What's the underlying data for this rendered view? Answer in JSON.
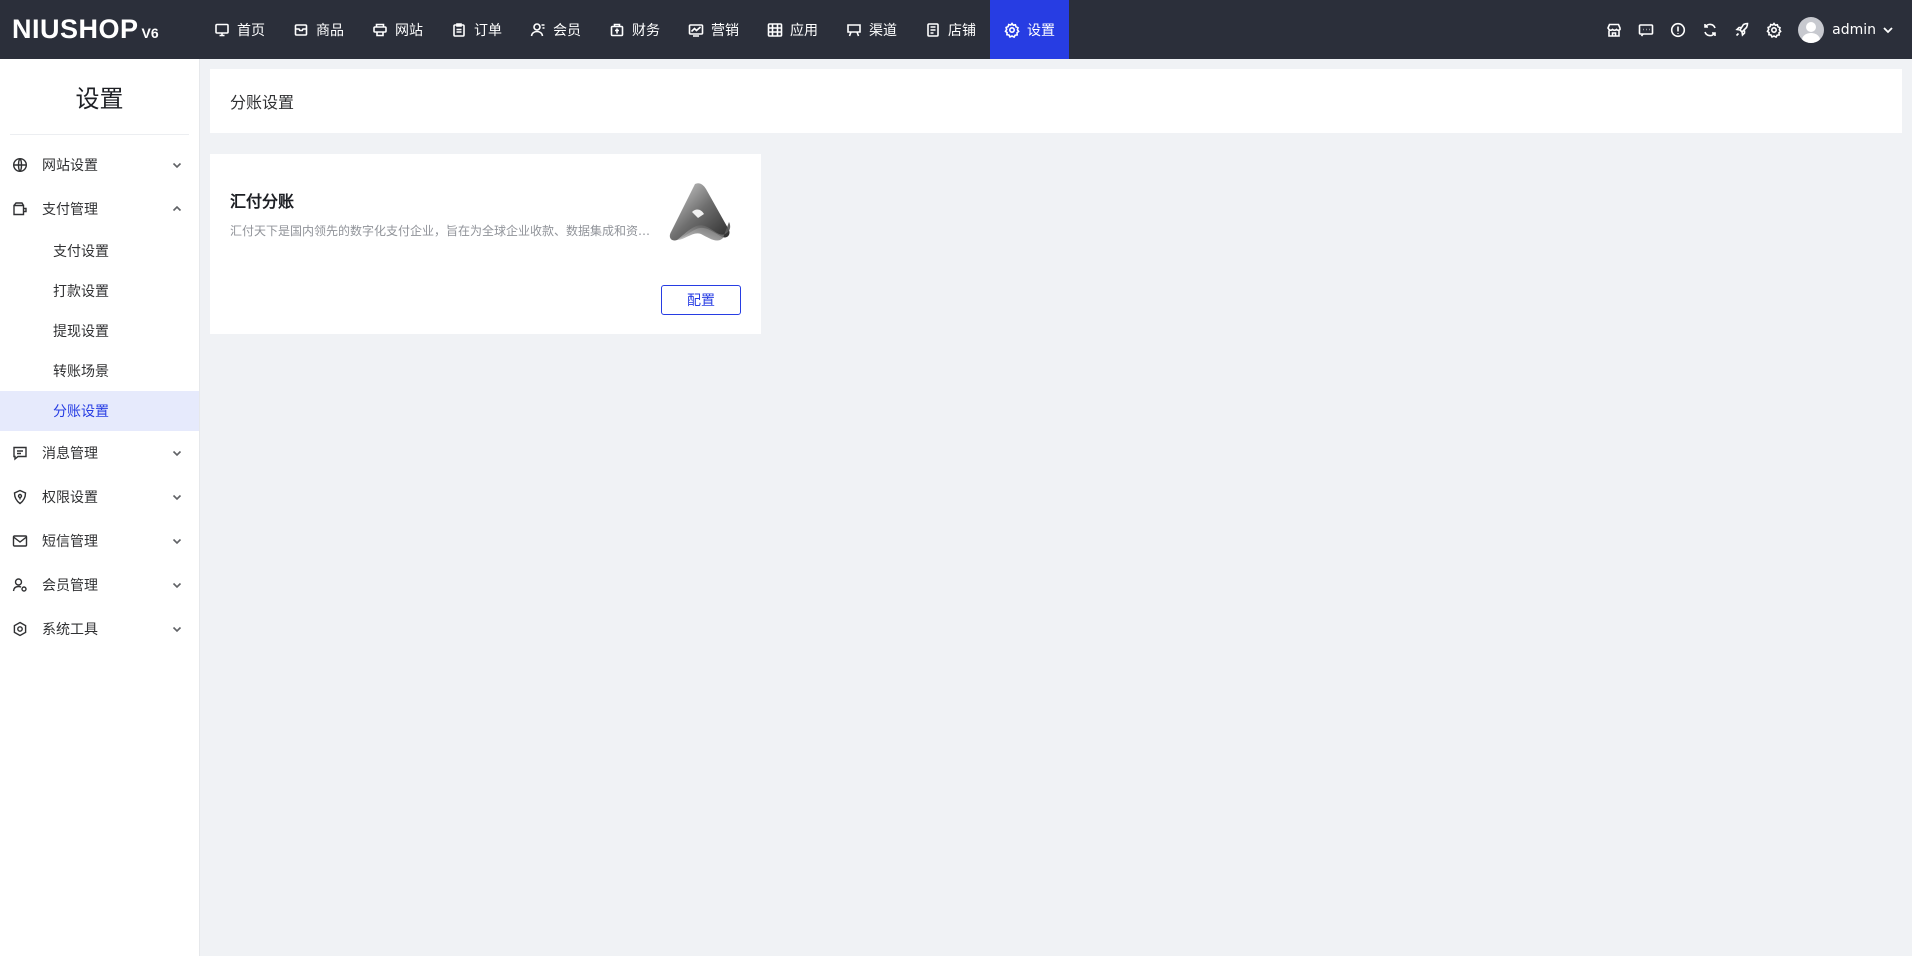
{
  "logo": {
    "text": "NIUSHOP",
    "version": "V6"
  },
  "nav": [
    {
      "label": "首页",
      "icon": "monitor-icon",
      "active": false
    },
    {
      "label": "商品",
      "icon": "box-icon",
      "active": false
    },
    {
      "label": "网站",
      "icon": "printer-icon",
      "active": false
    },
    {
      "label": "订单",
      "icon": "clipboard-icon",
      "active": false
    },
    {
      "label": "会员",
      "icon": "user-icon",
      "active": false
    },
    {
      "label": "财务",
      "icon": "wallet-icon",
      "active": false
    },
    {
      "label": "营销",
      "icon": "chart-icon",
      "active": false
    },
    {
      "label": "应用",
      "icon": "grid-icon",
      "active": false
    },
    {
      "label": "渠道",
      "icon": "display-icon",
      "active": false
    },
    {
      "label": "店铺",
      "icon": "document-icon",
      "active": false
    },
    {
      "label": "设置",
      "icon": "gear-icon",
      "active": true
    }
  ],
  "toolbar_icons": [
    "store-icon",
    "message-icon",
    "info-icon",
    "refresh-icon",
    "rocket-icon",
    "gear-icon"
  ],
  "user": {
    "name": "admin"
  },
  "sidebar": {
    "title": "设置",
    "menu": [
      {
        "label": "网站设置",
        "icon": "globe-icon",
        "expanded": false
      },
      {
        "label": "支付管理",
        "icon": "wallet-icon",
        "expanded": true,
        "children": [
          {
            "label": "支付设置",
            "active": false
          },
          {
            "label": "打款设置",
            "active": false
          },
          {
            "label": "提现设置",
            "active": false
          },
          {
            "label": "转账场景",
            "active": false
          },
          {
            "label": "分账设置",
            "active": true
          }
        ]
      },
      {
        "label": "消息管理",
        "icon": "message-icon",
        "expanded": false
      },
      {
        "label": "权限设置",
        "icon": "shield-icon",
        "expanded": false
      },
      {
        "label": "短信管理",
        "icon": "mail-icon",
        "expanded": false
      },
      {
        "label": "会员管理",
        "icon": "user-gear-icon",
        "expanded": false
      },
      {
        "label": "系统工具",
        "icon": "hexagon-gear-icon",
        "expanded": false
      }
    ]
  },
  "page": {
    "title": "分账设置",
    "card": {
      "title": "汇付分账",
      "description": "汇付天下是国内领先的数字化支付企业，旨在为全球企业收款、数据集成和资金管理提供服务",
      "button_label": "配置"
    }
  },
  "colors": {
    "topbar": "#2b2f3a",
    "accent": "#273de3",
    "active_bg": "#e6eafc"
  }
}
